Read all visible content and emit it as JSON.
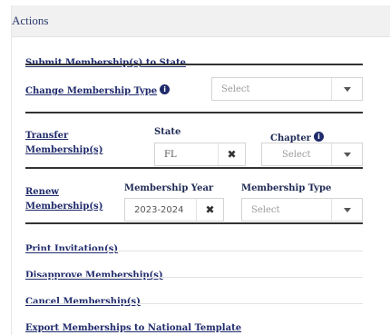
{
  "panel": {
    "title": "Actions"
  },
  "actions": {
    "submit": "Submit Membership(s) to State",
    "change_type": "Change Membership Type",
    "transfer_line1": "Transfer",
    "transfer_line2": "Membership(s)",
    "renew_line1": "Renew",
    "renew_line2": "Membership(s)",
    "print": "Print Invitation(s)",
    "disapprove": "Disapprove Membership(s)",
    "cancel": "Cancel Membership(s)",
    "export": "Export Memberships to National Template"
  },
  "change_type_select": {
    "placeholder": "Select"
  },
  "transfer": {
    "state_label": "State",
    "state_value": "FL",
    "chapter_label": "Chapter",
    "chapter_placeholder": "Select"
  },
  "renew": {
    "year_label": "Membership Year",
    "year_value": "2023-2024",
    "type_label": "Membership Type",
    "type_placeholder": "Select"
  },
  "icons": {
    "info": "i",
    "clear": "✖"
  },
  "colors": {
    "link": "#1f2a6b",
    "header_bg": "#f1f1f1",
    "divider": "#333333"
  }
}
